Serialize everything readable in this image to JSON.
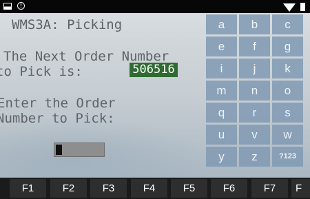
{
  "status_bar": {
    "icons": [
      "gallery-icon",
      "alert-icon",
      "wifi-icon",
      "battery-icon"
    ],
    "alert_glyph": "!"
  },
  "terminal": {
    "title": "WMS3A: Picking",
    "line1": "The Next Order Number",
    "line2": "to Pick is:",
    "order_number": "506516",
    "line3": "Enter the Order",
    "line4": "Number to Pick:",
    "input_value": ""
  },
  "keyboard": {
    "keys": [
      "a",
      "b",
      "c",
      "e",
      "f",
      "g",
      "i",
      "j",
      "k",
      "m",
      "n",
      "o",
      "q",
      "r",
      "s",
      "u",
      "v",
      "w",
      "y",
      "z",
      "?123"
    ]
  },
  "function_keys": [
    "F1",
    "F2",
    "F3",
    "F4",
    "F5",
    "F6",
    "F7",
    "F"
  ],
  "colors": {
    "highlight": "#2f6b32",
    "key_bg": "#829bb4",
    "fkey_bg": "#2e2e2e",
    "terminal_text": "#5f6468"
  }
}
